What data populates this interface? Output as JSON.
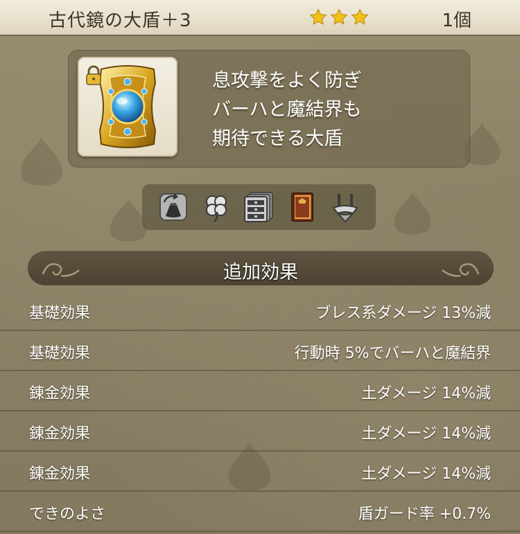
{
  "header": {
    "title": "古代鏡の大盾＋3",
    "stars": 3,
    "count": "1個"
  },
  "item": {
    "icon": "golden-mirror-shield-icon",
    "lock_icon": "lock-icon",
    "description": [
      "息攻撃をよく防ぎ",
      "バーハと魔結界も",
      "期待できる大盾"
    ]
  },
  "tags": [
    {
      "icon": "bag-recycle-icon"
    },
    {
      "icon": "clover-icon"
    },
    {
      "icon": "storage-drawer-icon"
    },
    {
      "icon": "book-icon"
    },
    {
      "icon": "equip-hook-icon"
    }
  ],
  "section": {
    "title": "追加効果"
  },
  "effects": [
    {
      "label": "基礎効果",
      "value": "ブレス系ダメージ  13%減"
    },
    {
      "label": "基礎効果",
      "value": "行動時  5%でバーハと魔結界"
    },
    {
      "label": "錬金効果",
      "value": "土ダメージ  14%減"
    },
    {
      "label": "錬金効果",
      "value": "土ダメージ  14%減"
    },
    {
      "label": "錬金効果",
      "value": "土ダメージ  14%減"
    },
    {
      "label": "できのよさ",
      "value": "盾ガード率  +0.7%"
    }
  ],
  "colors": {
    "header_bg": "#efe8d6",
    "panel_bg": "#8b8066",
    "star": "#f2c21b"
  }
}
